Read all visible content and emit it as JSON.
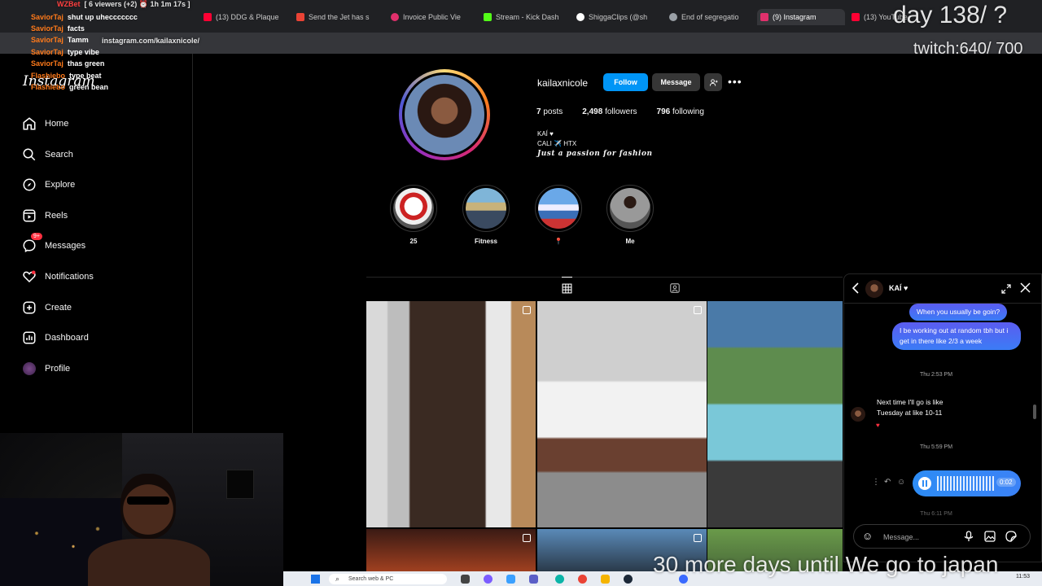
{
  "browser": {
    "tabs": [
      {
        "title": "6 viewers (+2) | ...",
        "color": "#1bb340"
      },
      {
        "title": "(13) DDG & Plaque",
        "color": "#ff0033"
      },
      {
        "title": "Send the Jet has s",
        "color": "#ea4335"
      },
      {
        "title": "Invoice Public Vie",
        "color": "#e1306c"
      },
      {
        "title": "Stream - Kick Dash",
        "color": "#53fc18"
      },
      {
        "title": "ShiggaClips (@sh",
        "color": "#ffffff"
      },
      {
        "title": "End of segregatio",
        "color": "#9aa0a6"
      },
      {
        "title": "(9) Instagram",
        "color": "#e1306c"
      },
      {
        "title": "(13) YouTube",
        "color": "#ff0033"
      }
    ],
    "url": "instagram.com/kailaxnicole/"
  },
  "stream_overlay": {
    "viewer_line": "[ 6 viewers (+2) ⏰ 1h 1m 17s ]",
    "top_user": "WZBet",
    "day_counter": "day 138/ ?",
    "twitch_counter": "twitch:640/ 700",
    "countdown": "30  more days until We go to japan",
    "chat": [
      {
        "user": "SaviorTaj",
        "message": "shut up uheccccccc"
      },
      {
        "user": "SaviorTaj",
        "message": "facts"
      },
      {
        "user": "SaviorTaj",
        "message": "Tamm"
      },
      {
        "user": "SaviorTaj",
        "message": "type vibe"
      },
      {
        "user": "SaviorTaj",
        "message": "thas green"
      },
      {
        "user": "Flashiebo",
        "message": "type beat"
      },
      {
        "user": "Flashiebo",
        "message": "green bean"
      }
    ]
  },
  "sidebar": {
    "logo": "Instagram",
    "items": [
      {
        "label": "Home",
        "icon": "home-icon"
      },
      {
        "label": "Search",
        "icon": "search-icon"
      },
      {
        "label": "Explore",
        "icon": "compass-icon"
      },
      {
        "label": "Reels",
        "icon": "reels-icon"
      },
      {
        "label": "Messages",
        "icon": "messenger-icon",
        "badge": "9+"
      },
      {
        "label": "Notifications",
        "icon": "heart-icon"
      },
      {
        "label": "Create",
        "icon": "plus-square-icon"
      },
      {
        "label": "Dashboard",
        "icon": "chart-icon"
      },
      {
        "label": "Profile",
        "icon": "avatar-icon"
      }
    ]
  },
  "profile": {
    "username": "kailaxnicole",
    "follow_label": "Follow",
    "message_label": "Message",
    "stats": {
      "posts_count": "7",
      "posts_label": "posts",
      "followers_count": "2,498",
      "followers_label": "followers",
      "following_count": "796",
      "following_label": "following"
    },
    "bio_name": "KAÍ ♥",
    "bio_line1": "CALI ✈️ HTX",
    "bio_line2": "Just a passion for fashion",
    "highlights": [
      {
        "label": "25"
      },
      {
        "label": "Fitness"
      },
      {
        "label": "📍"
      },
      {
        "label": "Me"
      }
    ]
  },
  "dm": {
    "name": "KAÍ ♥",
    "messages": {
      "out1": "When you usually be goin?",
      "out2": "I be working out at random tbh but i get in there like 2/3 a week",
      "ts1": "Thu 2:53 PM",
      "in1": "Next time I'll go is like Tuesday at like 10-11",
      "reaction": "♥",
      "ts2": "Thu 5:59 PM",
      "voice_duration": "0:02",
      "ts3": "Thu 6:11 PM"
    },
    "input_placeholder": "Message..."
  },
  "taskbar": {
    "search_placeholder": "Search web & PC",
    "time": "11:53"
  }
}
